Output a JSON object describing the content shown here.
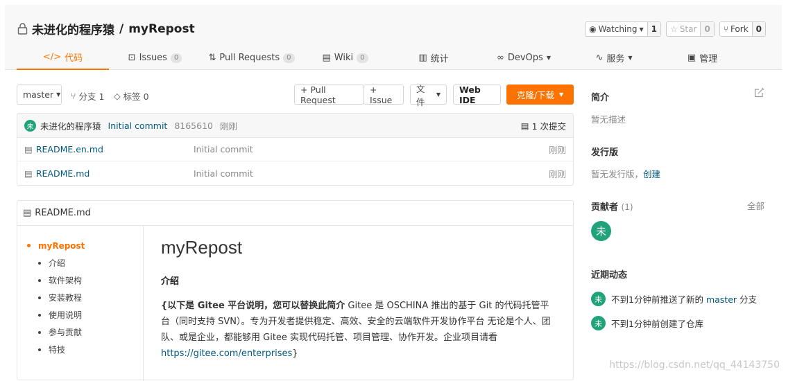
{
  "repo": {
    "owner": "未进化的程序猿",
    "separator": "/",
    "name": "myRepost"
  },
  "counters": {
    "watch": {
      "label": "Watching",
      "count": "1"
    },
    "star": {
      "label": "Star",
      "count": "0"
    },
    "fork": {
      "label": "Fork",
      "count": "0"
    }
  },
  "tabs": [
    {
      "label": "代码"
    },
    {
      "label": "Issues",
      "badge": "0"
    },
    {
      "label": "Pull Requests",
      "badge": "0"
    },
    {
      "label": "Wiki",
      "badge": "0"
    },
    {
      "label": "统计"
    },
    {
      "label": "DevOps"
    },
    {
      "label": "服务"
    },
    {
      "label": "管理"
    }
  ],
  "toolbar": {
    "branch": "master",
    "branches": "分支 1",
    "tags": "标签 0",
    "pull_request": "+ Pull Request",
    "issue": "+ Issue",
    "file": "文件",
    "web_ide": "Web IDE",
    "clone": "克隆/下载"
  },
  "last_commit": {
    "avatar": "未",
    "author": "未进化的程序猿",
    "message": "Initial commit",
    "hash": "8165610",
    "time": "刚刚",
    "count": "1 次提交"
  },
  "files": [
    {
      "name": "README.en.md",
      "message": "Initial commit",
      "time": "刚刚"
    },
    {
      "name": "README.md",
      "message": "Initial commit",
      "time": "刚刚"
    }
  ],
  "readme": {
    "filename": "README.md",
    "toc": [
      "myRepost",
      "介绍",
      "软件架构",
      "安装教程",
      "使用说明",
      "参与贡献",
      "特技"
    ],
    "title": "myRepost",
    "section": "介绍",
    "bold": "{以下是 Gitee 平台说明，您可以替换此简介",
    "body": " Gitee 是 OSCHINA 推出的基于 Git 的代码托管平台（同时支持 SVN）。专为开发者提供稳定、高效、安全的云端软件开发协作平台 无论是个人、团队、或是企业，都能够用 Gitee 实现代码托管、项目管理、协作开发。企业项目请看 ",
    "link": "https://gitee.com/enterprises",
    "end": "}"
  },
  "sidebar": {
    "intro_title": "简介",
    "intro_text": "暂无描述",
    "release_title": "发行版",
    "release_text": "暂无发行版，",
    "release_link": "创建",
    "contributors_title": "贡献者",
    "contributors_count": "(1)",
    "contributors_all": "全部",
    "contributor_avatar": "未",
    "activity_title": "近期动态",
    "activities": [
      {
        "avatar": "未",
        "prefix": "不到1分钟前推送了新的 ",
        "branch": "master",
        "suffix": " 分支"
      },
      {
        "avatar": "未",
        "text": "不到1分钟前创建了仓库"
      }
    ]
  },
  "watermark": "https://blog.csdn.net/qq_44143750",
  "colors": {
    "accent": "#fe7300",
    "link": "#005980",
    "avatar": "#20a37a"
  }
}
